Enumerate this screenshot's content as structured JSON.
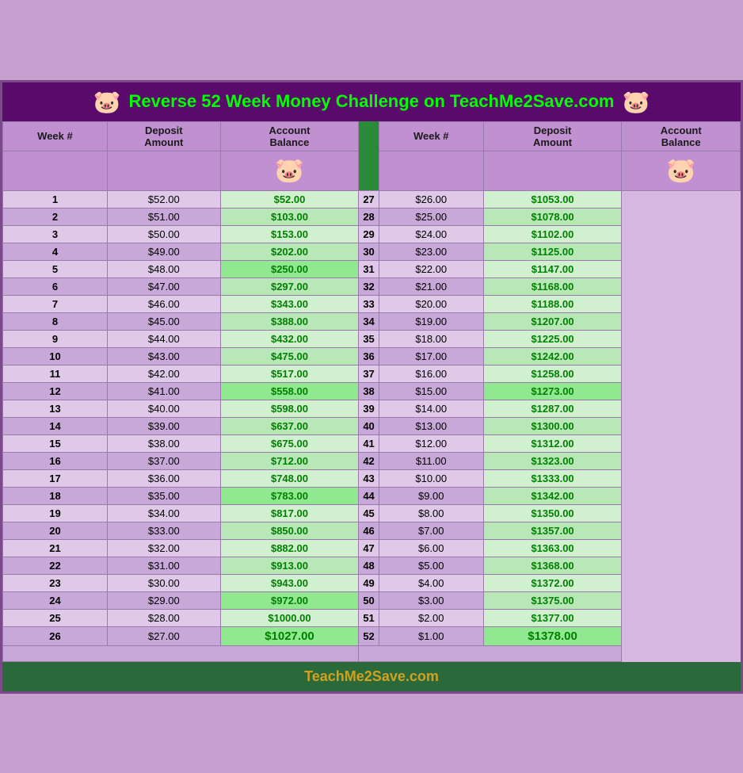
{
  "header": {
    "title": "Reverse 52 Week Money Challenge on TeachMe2Save.com",
    "pig_left": "🐷",
    "pig_right": "🐷"
  },
  "columns": {
    "week": "Week #",
    "deposit": "Deposit Amount",
    "balance": "Account Balance"
  },
  "left_table": [
    {
      "week": 1,
      "deposit": "$52.00",
      "balance": "$52.00"
    },
    {
      "week": 2,
      "deposit": "$51.00",
      "balance": "$103.00"
    },
    {
      "week": 3,
      "deposit": "$50.00",
      "balance": "$153.00"
    },
    {
      "week": 4,
      "deposit": "$49.00",
      "balance": "$202.00"
    },
    {
      "week": 5,
      "deposit": "$48.00",
      "balance": "$250.00"
    },
    {
      "week": 6,
      "deposit": "$47.00",
      "balance": "$297.00"
    },
    {
      "week": 7,
      "deposit": "$46.00",
      "balance": "$343.00"
    },
    {
      "week": 8,
      "deposit": "$45.00",
      "balance": "$388.00"
    },
    {
      "week": 9,
      "deposit": "$44.00",
      "balance": "$432.00"
    },
    {
      "week": 10,
      "deposit": "$43.00",
      "balance": "$475.00"
    },
    {
      "week": 11,
      "deposit": "$42.00",
      "balance": "$517.00"
    },
    {
      "week": 12,
      "deposit": "$41.00",
      "balance": "$558.00"
    },
    {
      "week": 13,
      "deposit": "$40.00",
      "balance": "$598.00"
    },
    {
      "week": 14,
      "deposit": "$39.00",
      "balance": "$637.00"
    },
    {
      "week": 15,
      "deposit": "$38.00",
      "balance": "$675.00"
    },
    {
      "week": 16,
      "deposit": "$37.00",
      "balance": "$712.00"
    },
    {
      "week": 17,
      "deposit": "$36.00",
      "balance": "$748.00"
    },
    {
      "week": 18,
      "deposit": "$35.00",
      "balance": "$783.00"
    },
    {
      "week": 19,
      "deposit": "$34.00",
      "balance": "$817.00"
    },
    {
      "week": 20,
      "deposit": "$33.00",
      "balance": "$850.00"
    },
    {
      "week": 21,
      "deposit": "$32.00",
      "balance": "$882.00"
    },
    {
      "week": 22,
      "deposit": "$31.00",
      "balance": "$913.00"
    },
    {
      "week": 23,
      "deposit": "$30.00",
      "balance": "$943.00"
    },
    {
      "week": 24,
      "deposit": "$29.00",
      "balance": "$972.00"
    },
    {
      "week": 25,
      "deposit": "$28.00",
      "balance": "$1000.00"
    },
    {
      "week": 26,
      "deposit": "$27.00",
      "balance": "$1027.00"
    }
  ],
  "right_table": [
    {
      "week": 27,
      "deposit": "$26.00",
      "balance": "$1053.00"
    },
    {
      "week": 28,
      "deposit": "$25.00",
      "balance": "$1078.00"
    },
    {
      "week": 29,
      "deposit": "$24.00",
      "balance": "$1102.00"
    },
    {
      "week": 30,
      "deposit": "$23.00",
      "balance": "$1125.00"
    },
    {
      "week": 31,
      "deposit": "$22.00",
      "balance": "$1147.00"
    },
    {
      "week": 32,
      "deposit": "$21.00",
      "balance": "$1168.00"
    },
    {
      "week": 33,
      "deposit": "$20.00",
      "balance": "$1188.00"
    },
    {
      "week": 34,
      "deposit": "$19.00",
      "balance": "$1207.00"
    },
    {
      "week": 35,
      "deposit": "$18.00",
      "balance": "$1225.00"
    },
    {
      "week": 36,
      "deposit": "$17.00",
      "balance": "$1242.00"
    },
    {
      "week": 37,
      "deposit": "$16.00",
      "balance": "$1258.00"
    },
    {
      "week": 38,
      "deposit": "$15.00",
      "balance": "$1273.00"
    },
    {
      "week": 39,
      "deposit": "$14.00",
      "balance": "$1287.00"
    },
    {
      "week": 40,
      "deposit": "$13.00",
      "balance": "$1300.00"
    },
    {
      "week": 41,
      "deposit": "$12.00",
      "balance": "$1312.00"
    },
    {
      "week": 42,
      "deposit": "$11.00",
      "balance": "$1323.00"
    },
    {
      "week": 43,
      "deposit": "$10.00",
      "balance": "$1333.00"
    },
    {
      "week": 44,
      "deposit": "$9.00",
      "balance": "$1342.00"
    },
    {
      "week": 45,
      "deposit": "$8.00",
      "balance": "$1350.00"
    },
    {
      "week": 46,
      "deposit": "$7.00",
      "balance": "$1357.00"
    },
    {
      "week": 47,
      "deposit": "$6.00",
      "balance": "$1363.00"
    },
    {
      "week": 48,
      "deposit": "$5.00",
      "balance": "$1368.00"
    },
    {
      "week": 49,
      "deposit": "$4.00",
      "balance": "$1372.00"
    },
    {
      "week": 50,
      "deposit": "$3.00",
      "balance": "$1375.00"
    },
    {
      "week": 51,
      "deposit": "$2.00",
      "balance": "$1377.00"
    },
    {
      "week": 52,
      "deposit": "$1.00",
      "balance": "$1378.00"
    }
  ],
  "footer": "TeachMe2Save.com",
  "pig_unicode": "🐷"
}
